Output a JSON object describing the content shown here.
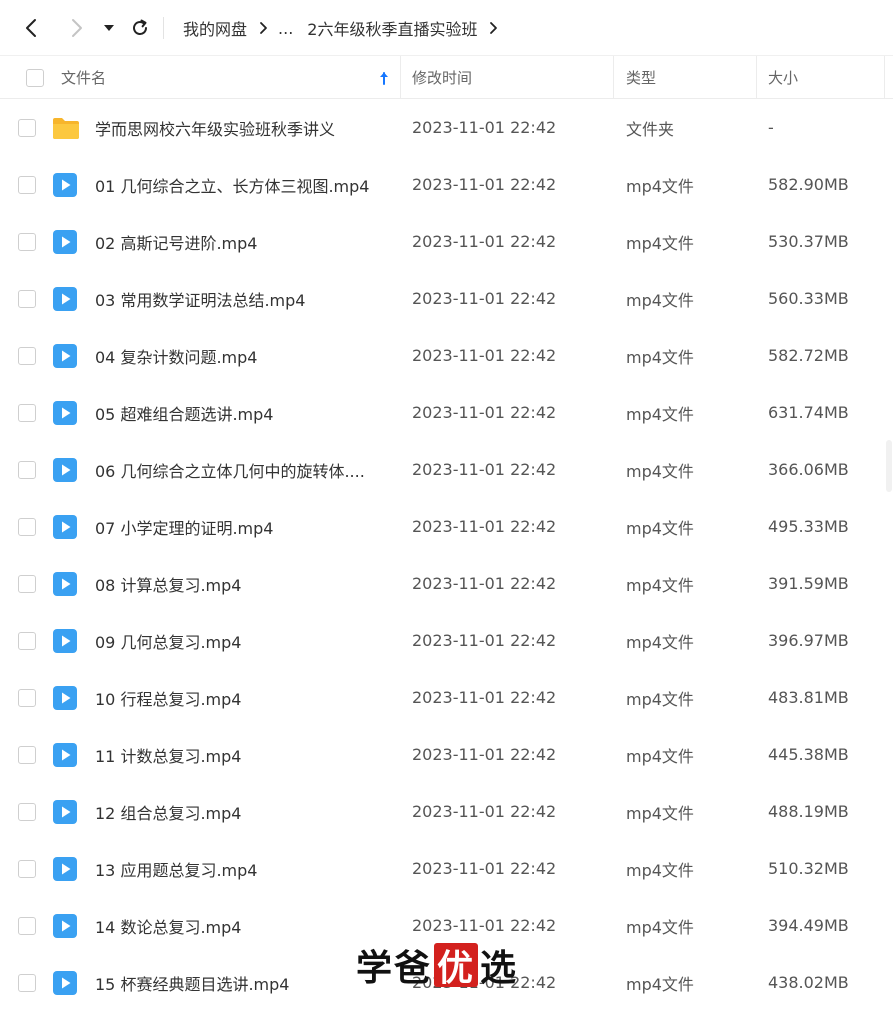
{
  "nav": {
    "breadcrumb": [
      {
        "label": "我的网盘"
      },
      {
        "label": "..."
      },
      {
        "label": "2六年级秋季直播实验班"
      }
    ]
  },
  "header": {
    "name": "文件名",
    "time": "修改时间",
    "type": "类型",
    "size": "大小",
    "sort": "ascending"
  },
  "colors": {
    "accent": "#1677ff",
    "folder": "#f7b52c",
    "video_icon": "#3aa1f2",
    "watermark_red": "#d3211e"
  },
  "files": [
    {
      "icon": "folder-icon",
      "name": "学而思网校六年级实验班秋季讲义",
      "time": "2023-11-01 22:42",
      "type": "文件夹",
      "size": "-"
    },
    {
      "icon": "video-file-icon",
      "name": "01 几何综合之立、长方体三视图.mp4",
      "time": "2023-11-01 22:42",
      "type": "mp4文件",
      "size": "582.90MB"
    },
    {
      "icon": "video-file-icon",
      "name": "02 高斯记号进阶.mp4",
      "time": "2023-11-01 22:42",
      "type": "mp4文件",
      "size": "530.37MB"
    },
    {
      "icon": "video-file-icon",
      "name": "03 常用数学证明法总结.mp4",
      "time": "2023-11-01 22:42",
      "type": "mp4文件",
      "size": "560.33MB"
    },
    {
      "icon": "video-file-icon",
      "name": "04 复杂计数问题.mp4",
      "time": "2023-11-01 22:42",
      "type": "mp4文件",
      "size": "582.72MB"
    },
    {
      "icon": "video-file-icon",
      "name": "05 超难组合题选讲.mp4",
      "time": "2023-11-01 22:42",
      "type": "mp4文件",
      "size": "631.74MB"
    },
    {
      "icon": "video-file-icon",
      "name": "06 几何综合之立体几何中的旋转体....",
      "time": "2023-11-01 22:42",
      "type": "mp4文件",
      "size": "366.06MB"
    },
    {
      "icon": "video-file-icon",
      "name": "07 小学定理的证明.mp4",
      "time": "2023-11-01 22:42",
      "type": "mp4文件",
      "size": "495.33MB"
    },
    {
      "icon": "video-file-icon",
      "name": "08 计算总复习.mp4",
      "time": "2023-11-01 22:42",
      "type": "mp4文件",
      "size": "391.59MB"
    },
    {
      "icon": "video-file-icon",
      "name": "09 几何总复习.mp4",
      "time": "2023-11-01 22:42",
      "type": "mp4文件",
      "size": "396.97MB"
    },
    {
      "icon": "video-file-icon",
      "name": "10 行程总复习.mp4",
      "time": "2023-11-01 22:42",
      "type": "mp4文件",
      "size": "483.81MB"
    },
    {
      "icon": "video-file-icon",
      "name": "11 计数总复习.mp4",
      "time": "2023-11-01 22:42",
      "type": "mp4文件",
      "size": "445.38MB"
    },
    {
      "icon": "video-file-icon",
      "name": "12 组合总复习.mp4",
      "time": "2023-11-01 22:42",
      "type": "mp4文件",
      "size": "488.19MB"
    },
    {
      "icon": "video-file-icon",
      "name": "13 应用题总复习.mp4",
      "time": "2023-11-01 22:42",
      "type": "mp4文件",
      "size": "510.32MB"
    },
    {
      "icon": "video-file-icon",
      "name": "14 数论总复习.mp4",
      "time": "2023-11-01 22:42",
      "type": "mp4文件",
      "size": "394.49MB"
    },
    {
      "icon": "video-file-icon",
      "name": "15 杯赛经典题目选讲.mp4",
      "time": "2023-11-01 22:42",
      "type": "mp4文件",
      "size": "438.02MB"
    }
  ],
  "watermark": {
    "part1": "学爸",
    "part2": "优",
    "part3": "选"
  }
}
